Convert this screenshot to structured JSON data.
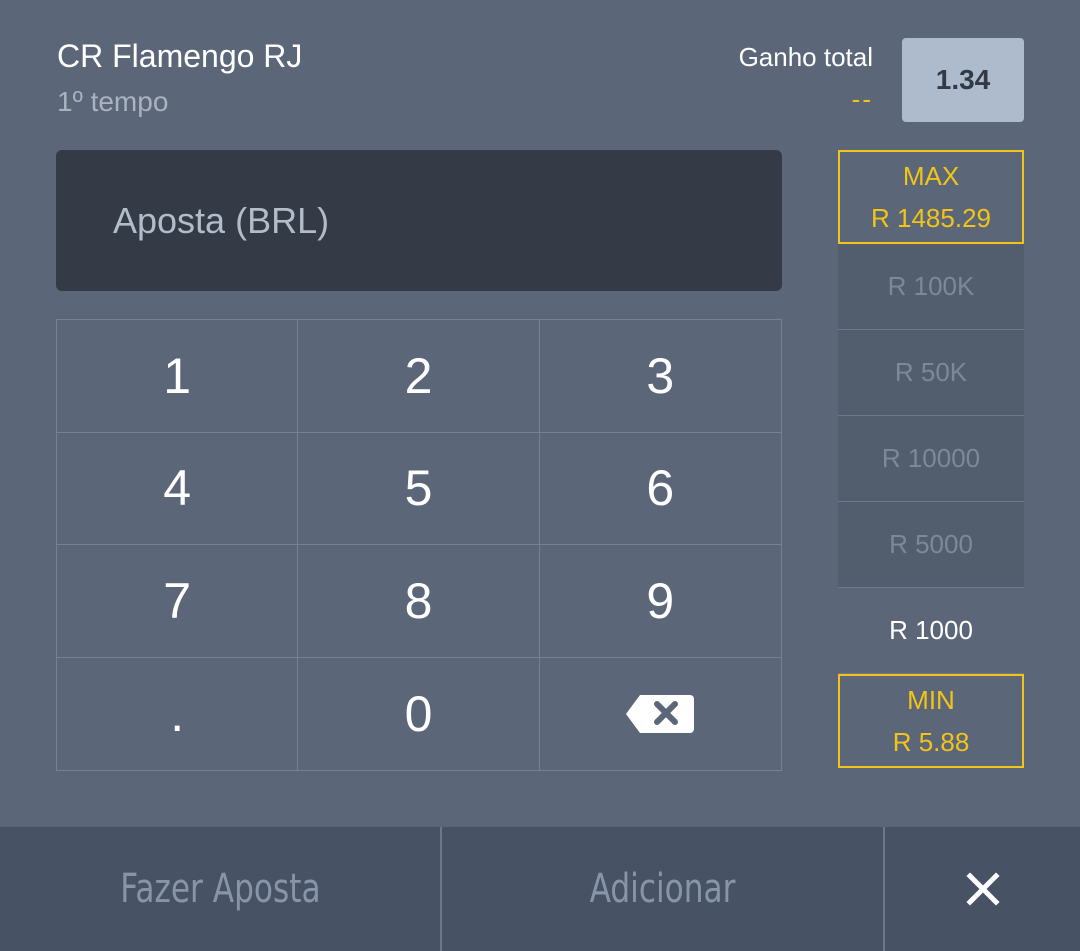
{
  "header": {
    "team": "CR Flamengo RJ",
    "period": "1º tempo",
    "total_label": "Ganho total",
    "total_value": "--",
    "odds": "1.34"
  },
  "stake": {
    "placeholder": "Aposta (BRL)",
    "value": ""
  },
  "keypad": {
    "keys": [
      "1",
      "2",
      "3",
      "4",
      "5",
      "6",
      "7",
      "8",
      "9",
      ".",
      "0"
    ],
    "backspace_icon": "backspace-icon"
  },
  "quick_amounts": {
    "max_label": "MAX",
    "max_value": "R 1485.29",
    "amounts": [
      "R 100K",
      "R 50K",
      "R 10000",
      "R 5000",
      "R 1000"
    ],
    "min_label": "MIN",
    "min_value": "R 5.88"
  },
  "footer": {
    "place_bet": "Fazer Aposta",
    "add": "Adicionar",
    "close_icon": "close-icon"
  },
  "colors": {
    "background": "#5b6779",
    "accent": "#f2c418",
    "input_bg": "#343a46",
    "footer_bg": "#475365"
  }
}
